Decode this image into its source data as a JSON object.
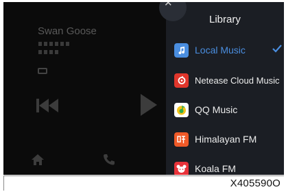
{
  "player": {
    "song_title": "Swan Goose"
  },
  "library": {
    "title": "Library",
    "close_symbol": "✕",
    "items": [
      {
        "label": "Local Music",
        "icon": "music-note-icon",
        "color": "#4a8ee0",
        "selected": true
      },
      {
        "label": "Netease Cloud Music",
        "icon": "netease-icon",
        "color": "#e0362c",
        "selected": false
      },
      {
        "label": "QQ Music",
        "icon": "qq-music-icon",
        "color": "#f2c21b",
        "selected": false
      },
      {
        "label": "Himalayan FM",
        "icon": "himalayan-icon",
        "color": "#f05a28",
        "selected": false
      },
      {
        "label": "Koala FM",
        "icon": "koala-icon",
        "color": "#e8333a",
        "selected": false
      }
    ]
  },
  "figure_id": "X405590O",
  "colors": {
    "accent": "#4a8ee0",
    "panel": "#1b1e24",
    "screen": "#0b0b0b"
  }
}
